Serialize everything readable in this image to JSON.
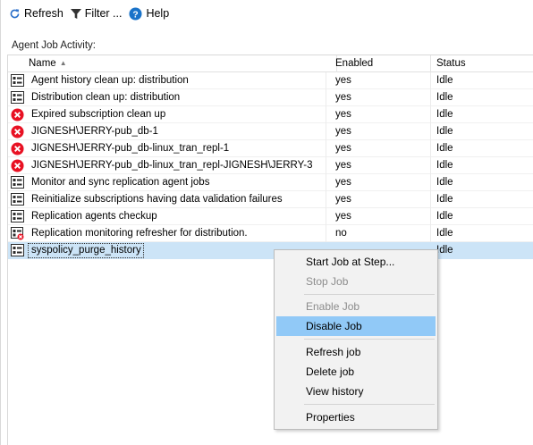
{
  "toolbar": {
    "refresh_label": "Refresh",
    "filter_label": "Filter ...",
    "help_label": "Help"
  },
  "section_label": "Agent Job Activity:",
  "columns": {
    "name": "Name",
    "enabled": "Enabled",
    "status": "Status"
  },
  "jobs": [
    {
      "name": "Agent history clean up: distribution",
      "enabled": "yes",
      "status": "Idle",
      "icon": "job-icon"
    },
    {
      "name": "Distribution clean up: distribution",
      "enabled": "yes",
      "status": "Idle",
      "icon": "job-icon"
    },
    {
      "name": "Expired subscription clean up",
      "enabled": "yes",
      "status": "Idle",
      "icon": "error-icon"
    },
    {
      "name": "JIGNESH\\JERRY-pub_db-1",
      "enabled": "yes",
      "status": "Idle",
      "icon": "error-icon"
    },
    {
      "name": "JIGNESH\\JERRY-pub_db-linux_tran_repl-1",
      "enabled": "yes",
      "status": "Idle",
      "icon": "error-icon"
    },
    {
      "name": "JIGNESH\\JERRY-pub_db-linux_tran_repl-JIGNESH\\JERRY-3",
      "enabled": "yes",
      "status": "Idle",
      "icon": "error-icon"
    },
    {
      "name": "Monitor and sync replication agent jobs",
      "enabled": "yes",
      "status": "Idle",
      "icon": "job-icon"
    },
    {
      "name": "Reinitialize subscriptions having data validation failures",
      "enabled": "yes",
      "status": "Idle",
      "icon": "job-icon"
    },
    {
      "name": "Replication agents checkup",
      "enabled": "yes",
      "status": "Idle",
      "icon": "job-icon"
    },
    {
      "name": "Replication monitoring refresher for distribution.",
      "enabled": "no",
      "status": "Idle",
      "icon": "disabled-job-icon"
    },
    {
      "name": "syspolicy_purge_history",
      "enabled": "",
      "status": "Idle",
      "icon": "job-icon",
      "selected": true
    }
  ],
  "context_menu": {
    "items": [
      {
        "label": "Start Job at Step...",
        "state": "enabled"
      },
      {
        "label": "Stop Job",
        "state": "disabled"
      },
      {
        "label": "Enable Job",
        "state": "disabled"
      },
      {
        "label": "Disable Job",
        "state": "hover"
      },
      {
        "label": "Refresh job",
        "state": "enabled"
      },
      {
        "label": "Delete job",
        "state": "enabled"
      },
      {
        "label": "View history",
        "state": "enabled"
      },
      {
        "label": "Properties",
        "state": "enabled"
      }
    ]
  },
  "colors": {
    "selection": "#cce4f7",
    "menu_hover": "#91c9f7",
    "error_red": "#e81123",
    "help_blue": "#1a73c9"
  }
}
